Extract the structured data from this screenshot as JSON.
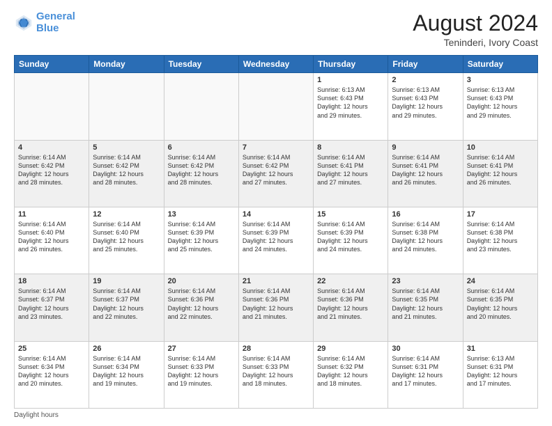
{
  "header": {
    "logo_line1": "General",
    "logo_line2": "Blue",
    "main_title": "August 2024",
    "subtitle": "Teninderi, Ivory Coast"
  },
  "calendar": {
    "days_of_week": [
      "Sunday",
      "Monday",
      "Tuesday",
      "Wednesday",
      "Thursday",
      "Friday",
      "Saturday"
    ],
    "weeks": [
      [
        {
          "day": "",
          "info": "",
          "empty": true
        },
        {
          "day": "",
          "info": "",
          "empty": true
        },
        {
          "day": "",
          "info": "",
          "empty": true
        },
        {
          "day": "",
          "info": "",
          "empty": true
        },
        {
          "day": "1",
          "info": "Sunrise: 6:13 AM\nSunset: 6:43 PM\nDaylight: 12 hours\nand 29 minutes.",
          "empty": false
        },
        {
          "day": "2",
          "info": "Sunrise: 6:13 AM\nSunset: 6:43 PM\nDaylight: 12 hours\nand 29 minutes.",
          "empty": false
        },
        {
          "day": "3",
          "info": "Sunrise: 6:13 AM\nSunset: 6:43 PM\nDaylight: 12 hours\nand 29 minutes.",
          "empty": false
        }
      ],
      [
        {
          "day": "4",
          "info": "Sunrise: 6:14 AM\nSunset: 6:42 PM\nDaylight: 12 hours\nand 28 minutes.",
          "empty": false
        },
        {
          "day": "5",
          "info": "Sunrise: 6:14 AM\nSunset: 6:42 PM\nDaylight: 12 hours\nand 28 minutes.",
          "empty": false
        },
        {
          "day": "6",
          "info": "Sunrise: 6:14 AM\nSunset: 6:42 PM\nDaylight: 12 hours\nand 28 minutes.",
          "empty": false
        },
        {
          "day": "7",
          "info": "Sunrise: 6:14 AM\nSunset: 6:42 PM\nDaylight: 12 hours\nand 27 minutes.",
          "empty": false
        },
        {
          "day": "8",
          "info": "Sunrise: 6:14 AM\nSunset: 6:41 PM\nDaylight: 12 hours\nand 27 minutes.",
          "empty": false
        },
        {
          "day": "9",
          "info": "Sunrise: 6:14 AM\nSunset: 6:41 PM\nDaylight: 12 hours\nand 26 minutes.",
          "empty": false
        },
        {
          "day": "10",
          "info": "Sunrise: 6:14 AM\nSunset: 6:41 PM\nDaylight: 12 hours\nand 26 minutes.",
          "empty": false
        }
      ],
      [
        {
          "day": "11",
          "info": "Sunrise: 6:14 AM\nSunset: 6:40 PM\nDaylight: 12 hours\nand 26 minutes.",
          "empty": false
        },
        {
          "day": "12",
          "info": "Sunrise: 6:14 AM\nSunset: 6:40 PM\nDaylight: 12 hours\nand 25 minutes.",
          "empty": false
        },
        {
          "day": "13",
          "info": "Sunrise: 6:14 AM\nSunset: 6:39 PM\nDaylight: 12 hours\nand 25 minutes.",
          "empty": false
        },
        {
          "day": "14",
          "info": "Sunrise: 6:14 AM\nSunset: 6:39 PM\nDaylight: 12 hours\nand 24 minutes.",
          "empty": false
        },
        {
          "day": "15",
          "info": "Sunrise: 6:14 AM\nSunset: 6:39 PM\nDaylight: 12 hours\nand 24 minutes.",
          "empty": false
        },
        {
          "day": "16",
          "info": "Sunrise: 6:14 AM\nSunset: 6:38 PM\nDaylight: 12 hours\nand 24 minutes.",
          "empty": false
        },
        {
          "day": "17",
          "info": "Sunrise: 6:14 AM\nSunset: 6:38 PM\nDaylight: 12 hours\nand 23 minutes.",
          "empty": false
        }
      ],
      [
        {
          "day": "18",
          "info": "Sunrise: 6:14 AM\nSunset: 6:37 PM\nDaylight: 12 hours\nand 23 minutes.",
          "empty": false
        },
        {
          "day": "19",
          "info": "Sunrise: 6:14 AM\nSunset: 6:37 PM\nDaylight: 12 hours\nand 22 minutes.",
          "empty": false
        },
        {
          "day": "20",
          "info": "Sunrise: 6:14 AM\nSunset: 6:36 PM\nDaylight: 12 hours\nand 22 minutes.",
          "empty": false
        },
        {
          "day": "21",
          "info": "Sunrise: 6:14 AM\nSunset: 6:36 PM\nDaylight: 12 hours\nand 21 minutes.",
          "empty": false
        },
        {
          "day": "22",
          "info": "Sunrise: 6:14 AM\nSunset: 6:36 PM\nDaylight: 12 hours\nand 21 minutes.",
          "empty": false
        },
        {
          "day": "23",
          "info": "Sunrise: 6:14 AM\nSunset: 6:35 PM\nDaylight: 12 hours\nand 21 minutes.",
          "empty": false
        },
        {
          "day": "24",
          "info": "Sunrise: 6:14 AM\nSunset: 6:35 PM\nDaylight: 12 hours\nand 20 minutes.",
          "empty": false
        }
      ],
      [
        {
          "day": "25",
          "info": "Sunrise: 6:14 AM\nSunset: 6:34 PM\nDaylight: 12 hours\nand 20 minutes.",
          "empty": false
        },
        {
          "day": "26",
          "info": "Sunrise: 6:14 AM\nSunset: 6:34 PM\nDaylight: 12 hours\nand 19 minutes.",
          "empty": false
        },
        {
          "day": "27",
          "info": "Sunrise: 6:14 AM\nSunset: 6:33 PM\nDaylight: 12 hours\nand 19 minutes.",
          "empty": false
        },
        {
          "day": "28",
          "info": "Sunrise: 6:14 AM\nSunset: 6:33 PM\nDaylight: 12 hours\nand 18 minutes.",
          "empty": false
        },
        {
          "day": "29",
          "info": "Sunrise: 6:14 AM\nSunset: 6:32 PM\nDaylight: 12 hours\nand 18 minutes.",
          "empty": false
        },
        {
          "day": "30",
          "info": "Sunrise: 6:14 AM\nSunset: 6:31 PM\nDaylight: 12 hours\nand 17 minutes.",
          "empty": false
        },
        {
          "day": "31",
          "info": "Sunrise: 6:13 AM\nSunset: 6:31 PM\nDaylight: 12 hours\nand 17 minutes.",
          "empty": false
        }
      ]
    ]
  },
  "footer": {
    "note": "Daylight hours"
  }
}
